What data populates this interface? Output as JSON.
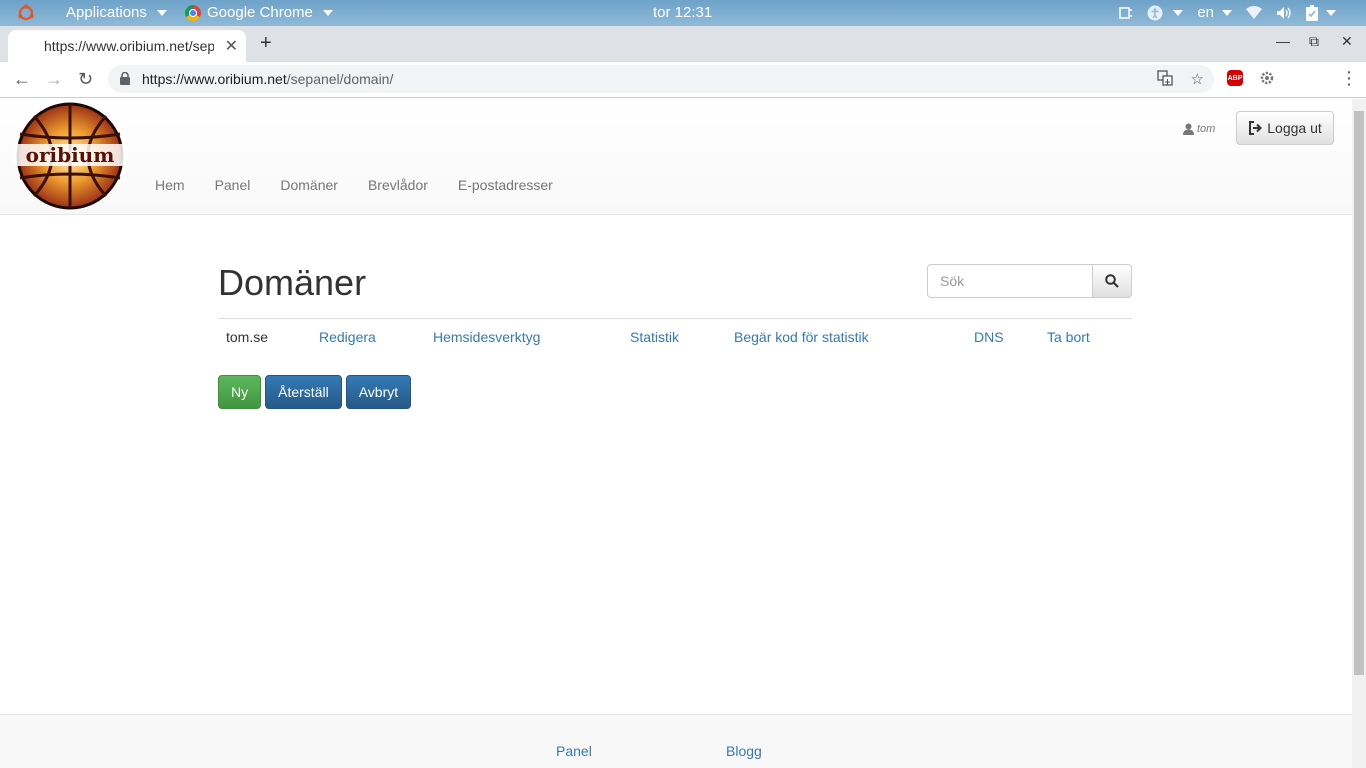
{
  "os_bar": {
    "applications_label": "Applications",
    "app_label": "Google Chrome",
    "clock": "tor 12:31",
    "language": "en"
  },
  "browser": {
    "tab_title": "https://www.oribium.net/sepanel/domain/",
    "url_host": "https://www.oribium.net",
    "url_path": "/sepanel/domain/",
    "abp_label": "ABP"
  },
  "site": {
    "logo_text": "oribium",
    "nav": [
      "Hem",
      "Panel",
      "Domäner",
      "Brevlådor",
      "E-postadresser"
    ],
    "user": "tom",
    "logout_label": "Logga ut"
  },
  "main": {
    "heading": "Domäner",
    "search_placeholder": "Sök",
    "row": {
      "domain": "tom.se",
      "edit": "Redigera",
      "site_tools": "Hemsidesverktyg",
      "stats": "Statistik",
      "stats_code": "Begär kod för statistik",
      "dns": "DNS",
      "delete": "Ta bort"
    },
    "buttons": {
      "new": "Ny",
      "reset": "Återställ",
      "cancel": "Avbryt"
    }
  },
  "footer": {
    "links": [
      "Panel",
      "Blogg"
    ]
  },
  "colors": {
    "link": "#337ab7",
    "success": "#5cb85c",
    "primary": "#337ab7",
    "logo_red": "#8b1a10",
    "logo_orange": "#e8781a"
  }
}
